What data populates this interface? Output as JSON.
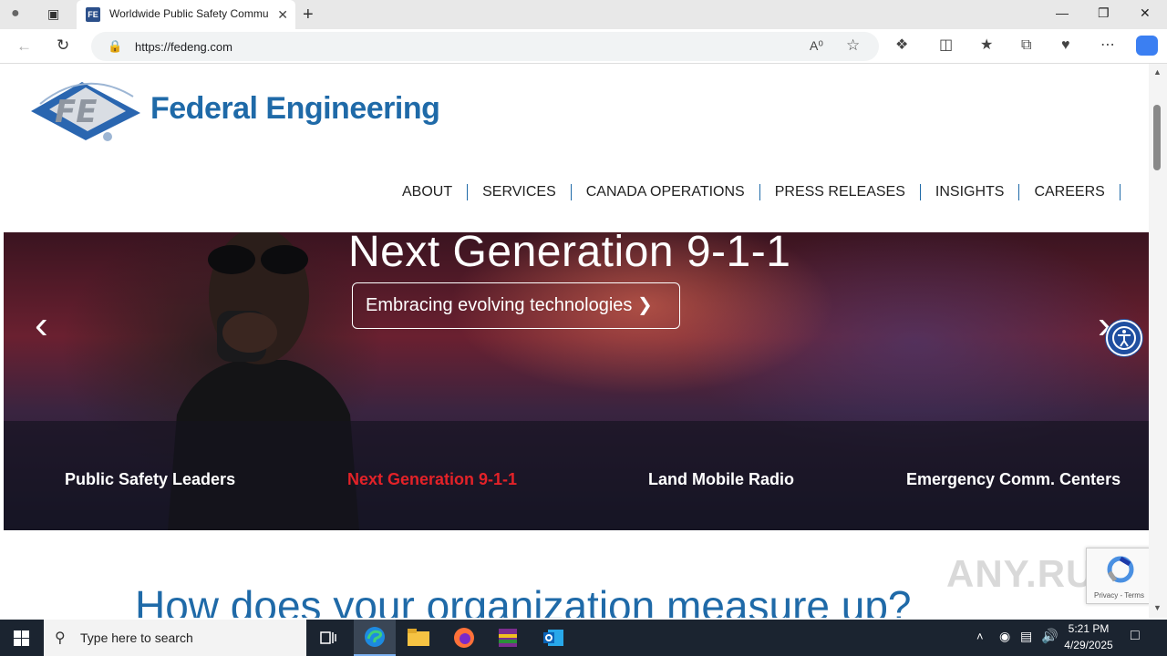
{
  "browser": {
    "tab_title": "Worldwide Public Safety Commu",
    "favicon_text": "FE",
    "url": "https://fedeng.com"
  },
  "site": {
    "logo_text": "Federal Engineering",
    "nav": [
      "ABOUT",
      "SERVICES",
      "CANADA OPERATIONS",
      "PRESS RELEASES",
      "INSIGHTS",
      "CAREERS"
    ]
  },
  "hero": {
    "title": "Next Generation 9-1-1",
    "button_label": "Embracing evolving technologies",
    "slides": [
      {
        "label": "Public Safety Leaders",
        "active": false
      },
      {
        "label": "Next Generation 9-1-1",
        "active": true
      },
      {
        "label": "Land Mobile Radio",
        "active": false
      },
      {
        "label": "Emergency Comm. Centers",
        "active": false
      }
    ]
  },
  "main": {
    "headline": "How does your organization measure up?"
  },
  "recaptcha": {
    "terms": "Privacy - Terms"
  },
  "watermark": "ANY.RUN",
  "taskbar": {
    "search_placeholder": "Type here to search",
    "time": "5:21 PM",
    "date": "4/29/2025"
  },
  "colors": {
    "brand_blue": "#1f6aa8",
    "active_red": "#e32228",
    "taskbar": "#1b2430"
  }
}
